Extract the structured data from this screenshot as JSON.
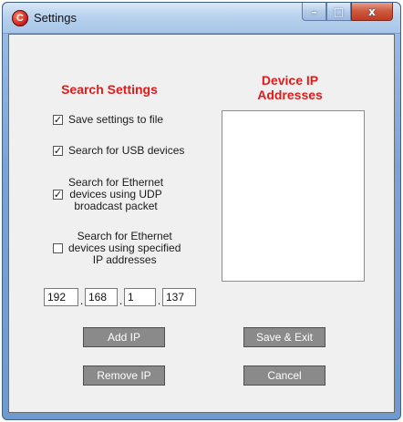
{
  "window": {
    "title": "Settings",
    "app_icon_glyph": "C",
    "caption_minimize": "–",
    "caption_maximize": "□",
    "caption_close": "x"
  },
  "search_settings": {
    "heading": "Search Settings",
    "options": [
      {
        "label_lines": [
          "Save settings to file"
        ],
        "checked": true
      },
      {
        "label_lines": [
          "Search for USB devices"
        ],
        "checked": true
      },
      {
        "label_lines": [
          "Search for Ethernet",
          "devices using UDP",
          "broadcast packet"
        ],
        "checked": true
      },
      {
        "label_lines": [
          "Search for Ethernet",
          "devices using specified",
          "IP addresses"
        ],
        "checked": false
      }
    ],
    "check_glyph": "✓"
  },
  "device_ip": {
    "heading_lines": [
      "Device IP",
      "Addresses"
    ],
    "items": []
  },
  "ip_input": {
    "octets": [
      "192",
      "168",
      "1",
      "137"
    ],
    "separator": "."
  },
  "buttons": {
    "add_ip": "Add IP",
    "remove_ip": "Remove IP",
    "save_exit": "Save & Exit",
    "cancel": "Cancel"
  },
  "colors": {
    "heading": "#e01b1b",
    "button_bg": "#8a8a8a",
    "client_bg": "#f0f0f0"
  }
}
